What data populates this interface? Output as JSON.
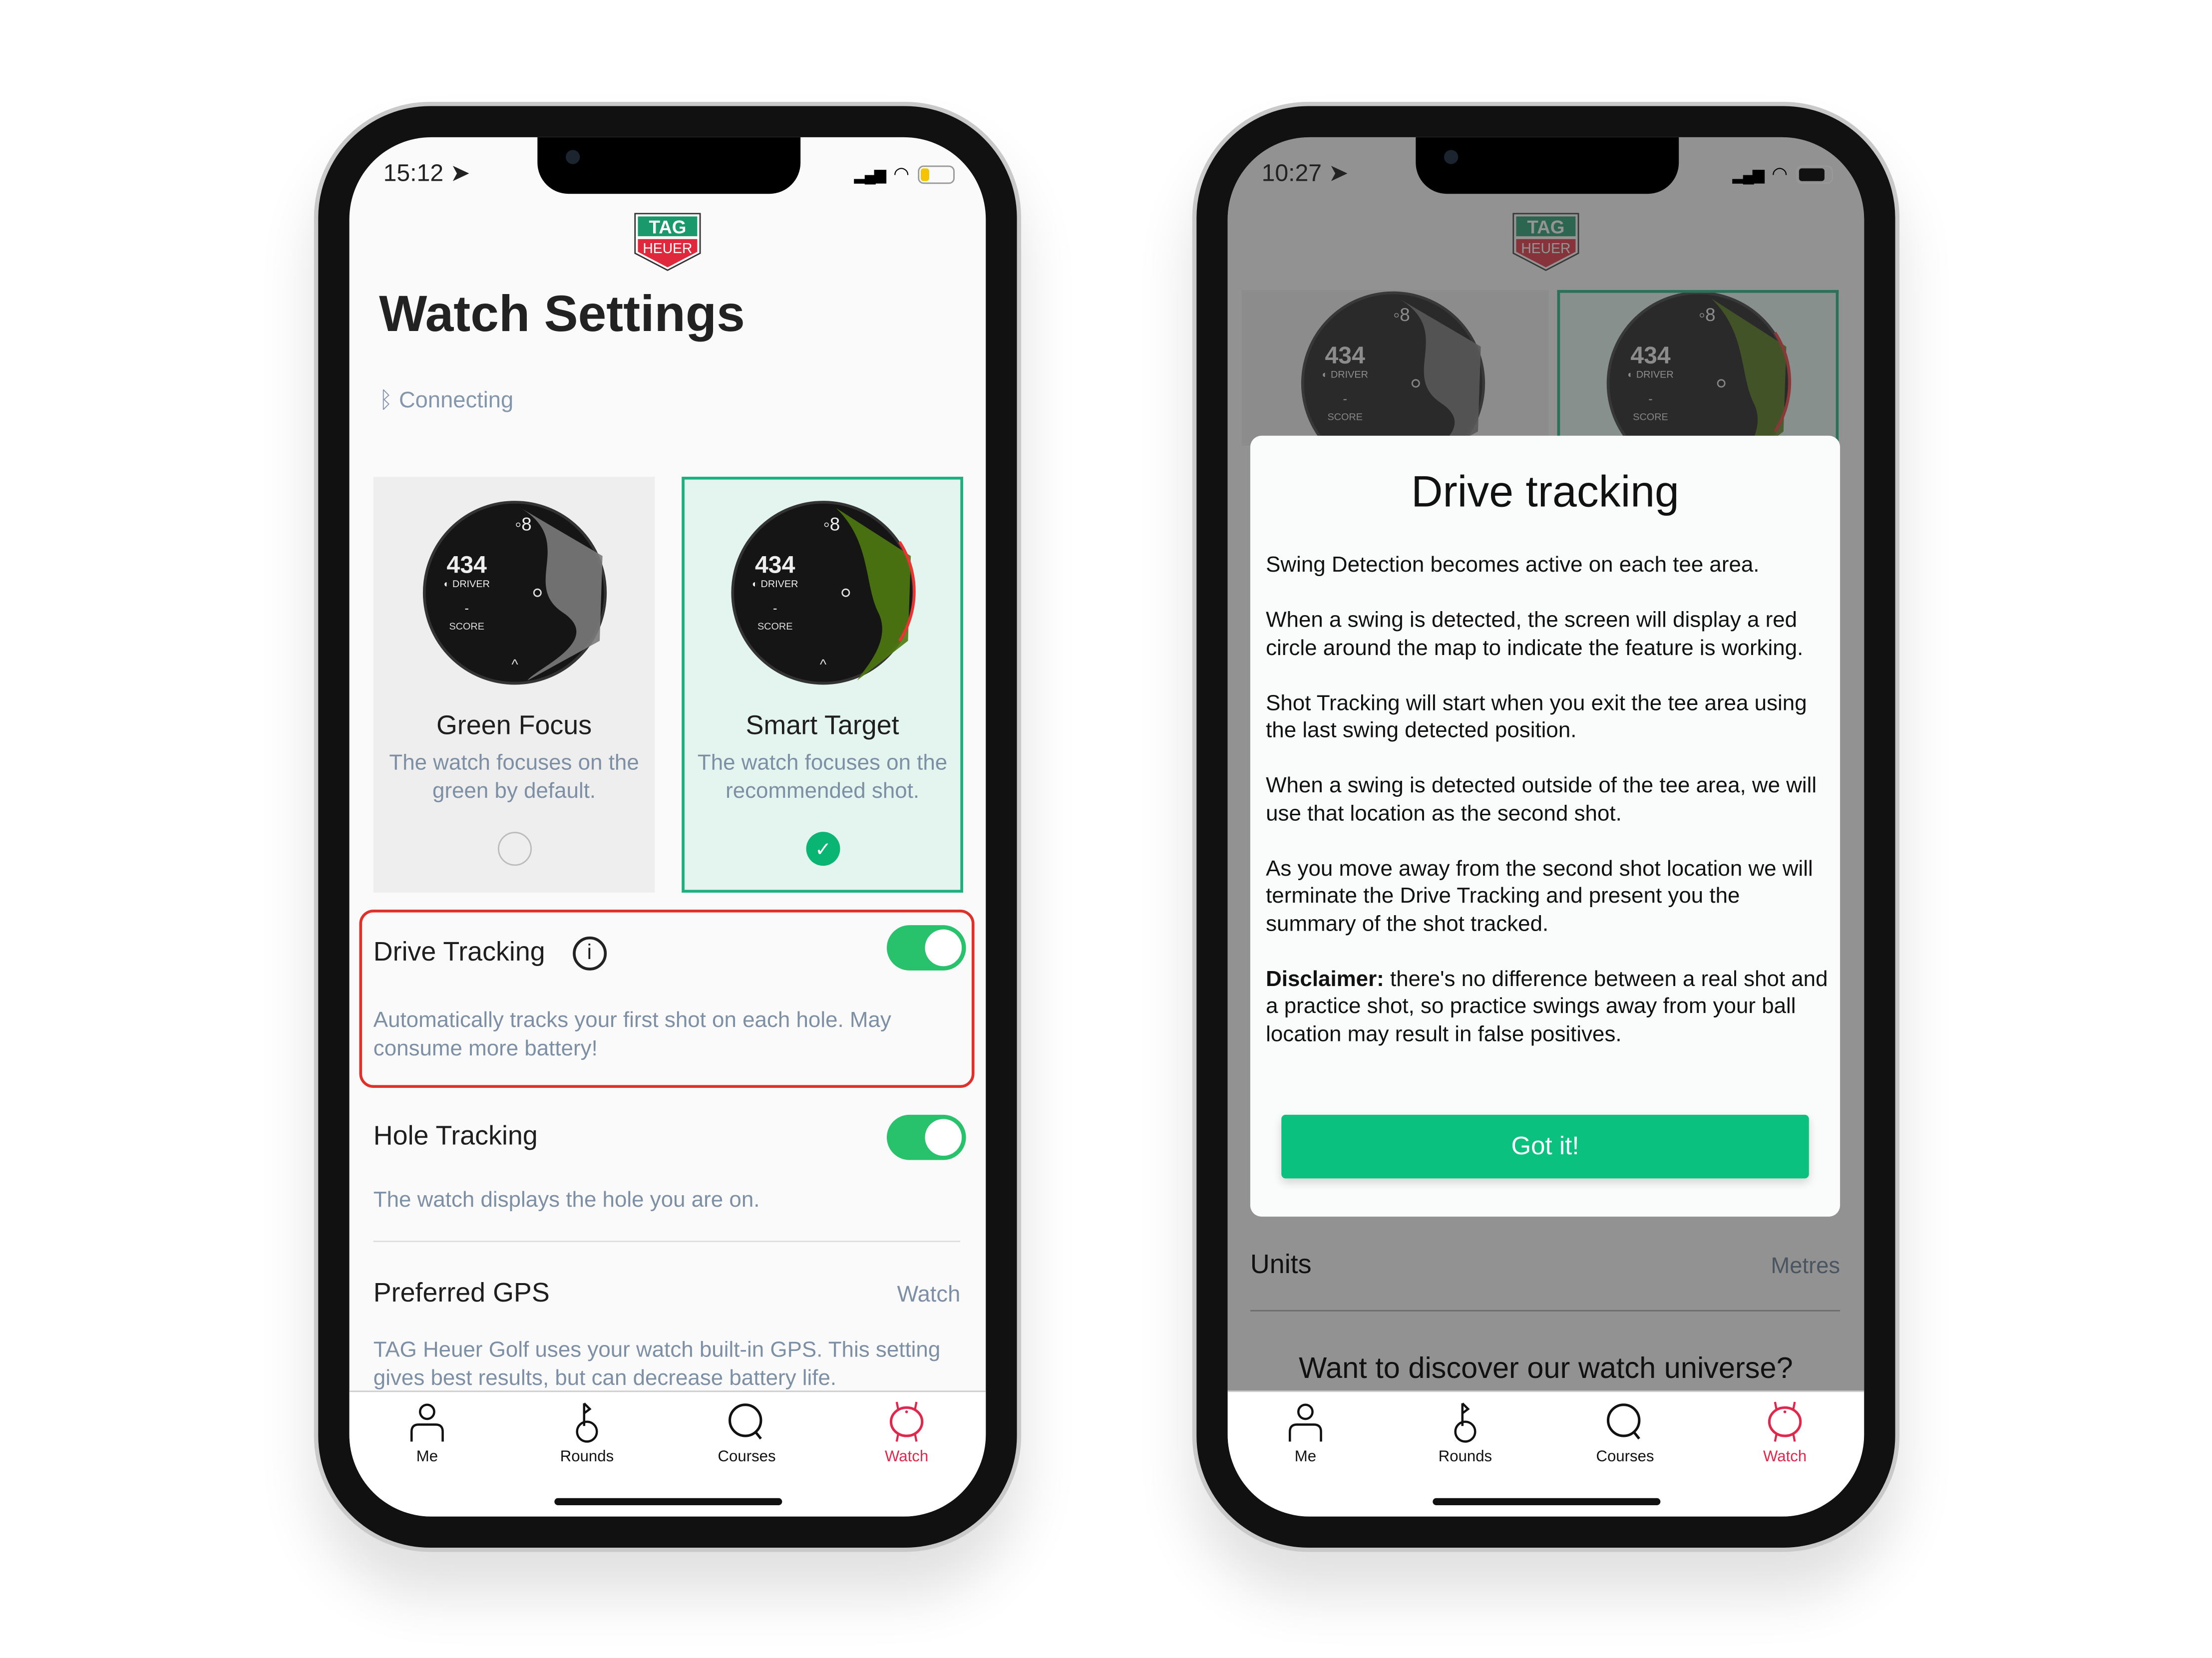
{
  "colors": {
    "accent": "#27c26b",
    "brand_green": "#1a9a6c",
    "brand_red": "#e0283c",
    "highlight_red": "#e0302a",
    "active_tab": "#e0284c",
    "button": "#0ac17f",
    "muted_text": "#7d8fa5"
  },
  "logo": {
    "line1": "TAG",
    "line2": "HEUER"
  },
  "phone1": {
    "status": {
      "time": "15:12",
      "battery_level": 0.25,
      "battery_color": "#f5c400"
    },
    "title": "Watch Settings",
    "connection": {
      "icon": "bluetooth-icon",
      "label": "Connecting"
    },
    "watch_faces": [
      {
        "name": "Green Focus",
        "description": "The watch focuses on the green by default.",
        "selected": false,
        "face": {
          "hole": "8",
          "distance": "434",
          "club": "DRIVER",
          "score": "-",
          "score_label": "SCORE"
        }
      },
      {
        "name": "Smart Target",
        "description": "The watch focuses on the recommended shot.",
        "selected": true,
        "face": {
          "hole": "8",
          "distance": "434",
          "club": "DRIVER",
          "score": "-",
          "score_label": "SCORE"
        }
      }
    ],
    "drive_tracking": {
      "label": "Drive Tracking",
      "info_icon": "info-icon",
      "enabled": true,
      "description": "Automatically tracks your first shot on each hole. May consume more battery!"
    },
    "hole_tracking": {
      "label": "Hole Tracking",
      "enabled": true,
      "description": "The watch displays the hole you are on."
    },
    "preferred_gps": {
      "label": "Preferred GPS",
      "value": "Watch",
      "description": "TAG Heuer Golf uses your watch built-in GPS. This setting gives best results, but can decrease battery life."
    }
  },
  "phone2": {
    "status": {
      "time": "10:27",
      "battery_level": 0.8,
      "battery_color": "#111111"
    },
    "modal": {
      "title": "Drive tracking",
      "paragraphs": [
        "Swing Detection becomes active on each tee area.",
        "When a swing is detected, the screen will display a red circle around the map to indicate the feature is working.",
        "Shot Tracking will start when you exit the tee area using the last swing detected position.",
        "When a swing is detected outside of the tee area, we will use that location as the second shot.",
        "As you move away from the second shot location we will terminate the Drive Tracking and present you the summary of the shot tracked."
      ],
      "disclaimer_label": "Disclaimer:",
      "disclaimer_text": " there's no difference between a real shot and a practice shot, so practice swings away from your ball location may result in false positives.",
      "button": "Got it!"
    },
    "units": {
      "label": "Units",
      "value": "Metres"
    },
    "discover": "Want to discover our watch universe?"
  },
  "tabs": [
    {
      "label": "Me",
      "icon": "person-icon",
      "active": false
    },
    {
      "label": "Rounds",
      "icon": "golf-flag-icon",
      "active": false
    },
    {
      "label": "Courses",
      "icon": "search-icon",
      "active": false
    },
    {
      "label": "Watch",
      "icon": "watch-icon",
      "active": true
    }
  ]
}
